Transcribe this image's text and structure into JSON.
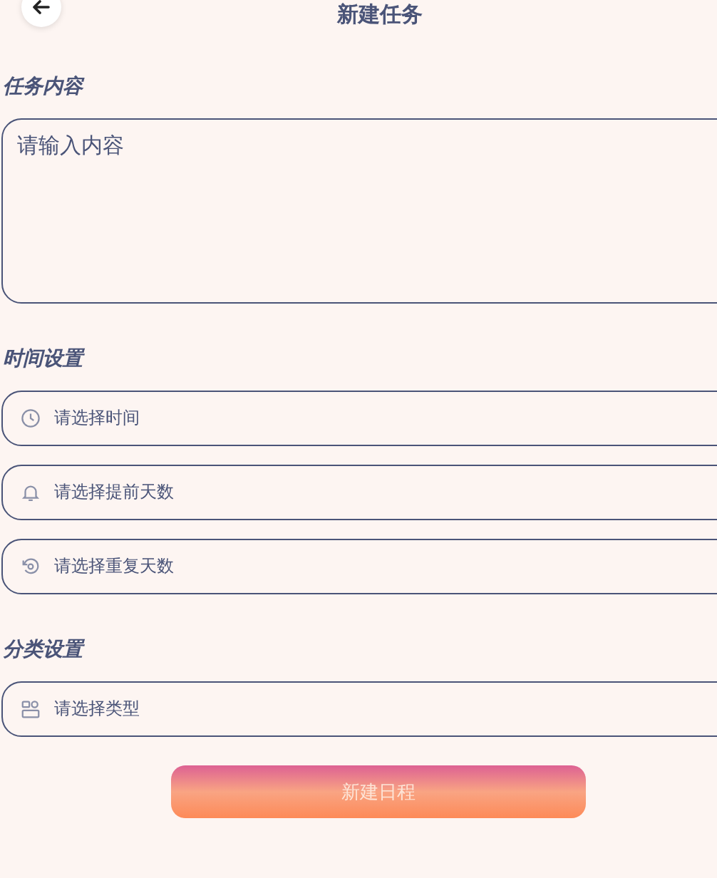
{
  "header": {
    "title": "新建任务"
  },
  "sections": [
    {
      "label": "任务内容",
      "fields": [
        {
          "kind": "textarea",
          "placeholder": "请输入内容"
        }
      ]
    },
    {
      "label": "时间设置",
      "fields": [
        {
          "kind": "time",
          "placeholder": "请选择时间"
        },
        {
          "kind": "remind",
          "placeholder": "请选择提前天数"
        },
        {
          "kind": "repeat",
          "placeholder": "请选择重复天数"
        }
      ]
    },
    {
      "label": "分类设置",
      "fields": [
        {
          "kind": "category",
          "placeholder": "请选择类型"
        }
      ]
    }
  ],
  "submit": {
    "label": "新建日程"
  }
}
